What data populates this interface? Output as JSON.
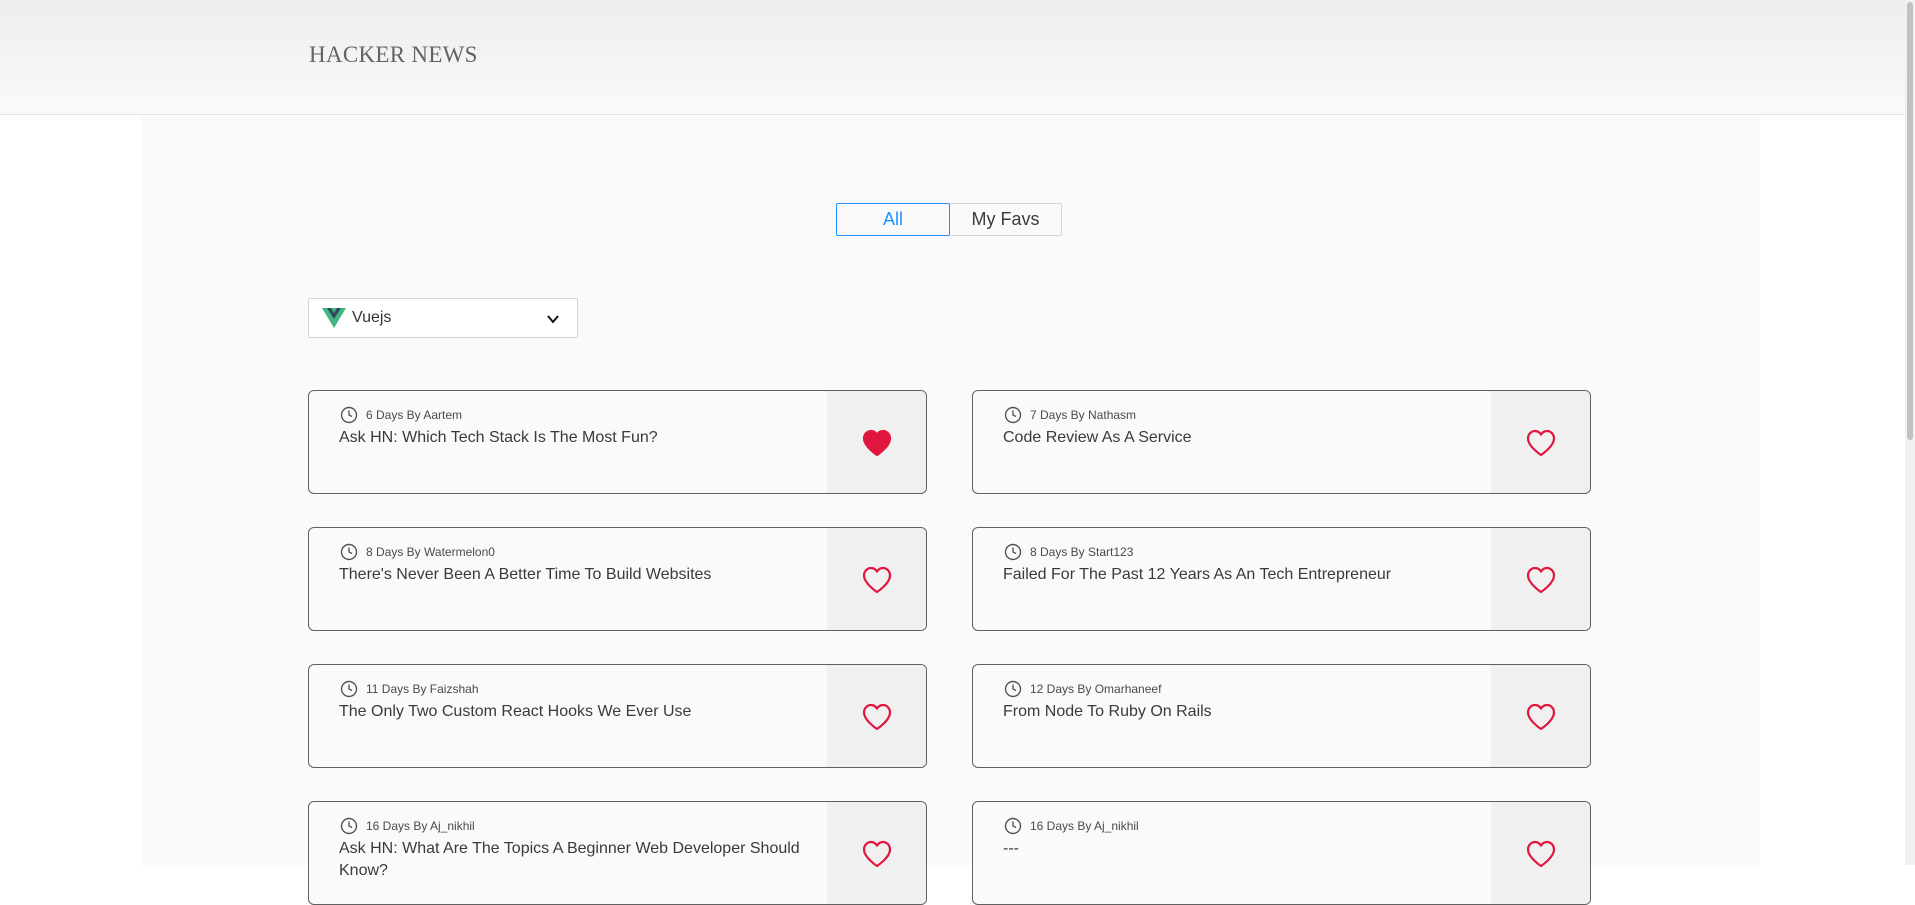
{
  "header": {
    "brand": "HACKER NEWS"
  },
  "tabs": [
    {
      "label": "All",
      "active": true
    },
    {
      "label": "My Favs",
      "active": false
    }
  ],
  "filter": {
    "selected": "Vuejs",
    "icon": "vue-logo-icon"
  },
  "colors": {
    "accent": "#1e90ff",
    "heart": "#e0163f"
  },
  "posts": [
    {
      "meta": "6 Days By Aartem",
      "title": "Ask HN: Which Tech Stack Is The Most Fun?",
      "favorited": true
    },
    {
      "meta": "7 Days By Nathasm",
      "title": "Code Review As A Service",
      "favorited": false
    },
    {
      "meta": "8 Days By Watermelon0",
      "title": "There's Never Been A Better Time To Build Websites",
      "favorited": false
    },
    {
      "meta": "8 Days By Start123",
      "title": "Failed For The Past 12 Years As An Tech Entrepreneur",
      "favorited": false
    },
    {
      "meta": "11 Days By Faizshah",
      "title": "The Only Two Custom React Hooks We Ever Use",
      "favorited": false
    },
    {
      "meta": "12 Days By Omarhaneef",
      "title": "From Node To Ruby On Rails",
      "favorited": false
    },
    {
      "meta": "16 Days By Aj_nikhil",
      "title": "Ask HN: What Are The Topics A Beginner Web Developer Should Know?",
      "favorited": false
    },
    {
      "meta": "16 Days By Aj_nikhil",
      "title": "---",
      "favorited": false
    }
  ]
}
